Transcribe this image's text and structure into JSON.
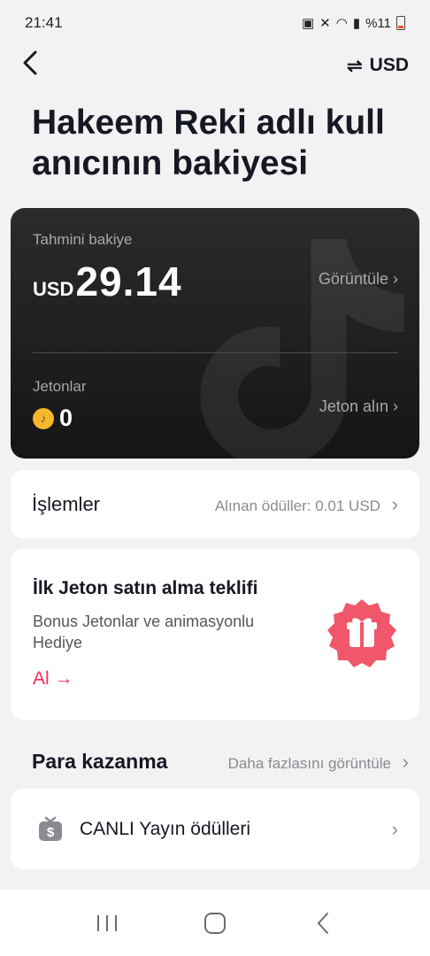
{
  "status_bar": {
    "time": "21:41",
    "battery": "%11"
  },
  "header": {
    "currency": "USD"
  },
  "title": "Hakeem Reki adlı kullanıcının bakiyesi",
  "balance": {
    "label": "Tahmini bakiye",
    "unit": "USD",
    "value": "29.14",
    "view_link": "Görüntüle",
    "coins_label": "Jetonlar",
    "coins_value": "0",
    "buy_link": "Jeton alın"
  },
  "transactions": {
    "title": "İşlemler",
    "received": "Alınan ödüller: 0.01 USD"
  },
  "offer": {
    "title": "İlk Jeton satın alma teklifi",
    "description": "Bonus Jetonlar ve animasyonlu Hediye",
    "action": "Al →"
  },
  "earn": {
    "title": "Para kazanma",
    "more": "Daha fazlasını görüntüle",
    "live_rewards": "CANLI Yayın ödülleri"
  },
  "colors": {
    "accent": "#fe2c55",
    "card_dark": "#1c1c1e",
    "coin": "#f5b72b"
  }
}
